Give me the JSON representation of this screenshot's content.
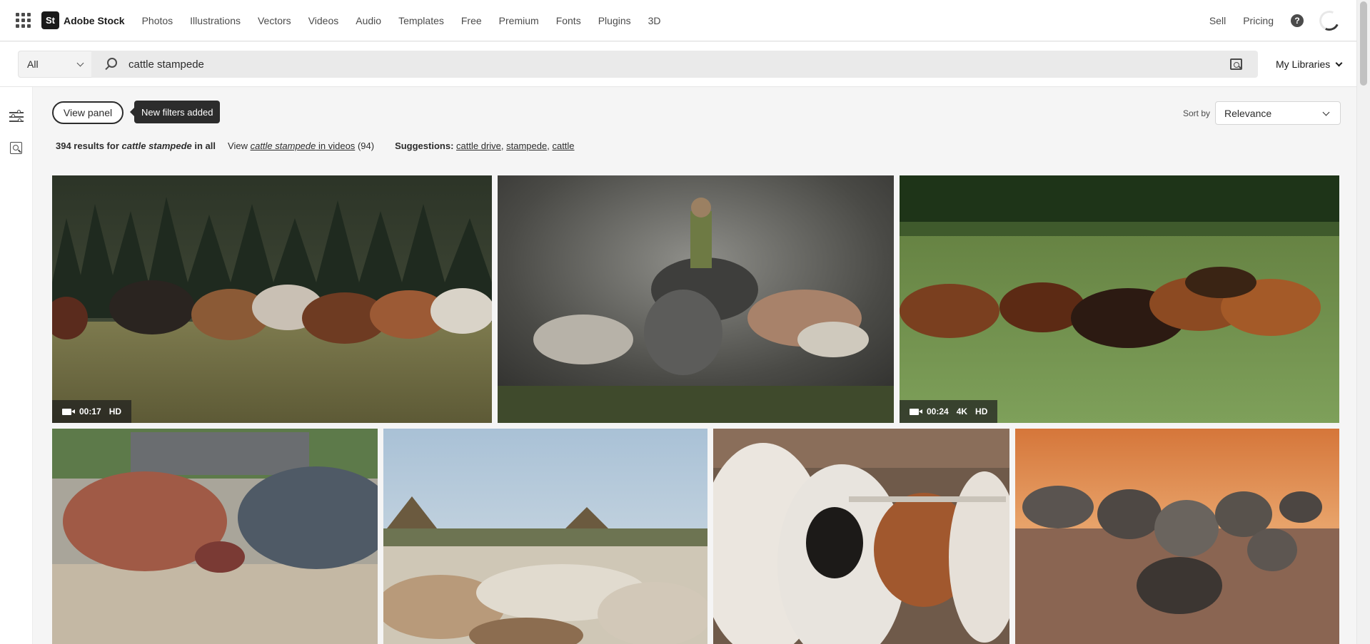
{
  "nav": {
    "brand_mark": "St",
    "brand": "Adobe Stock",
    "items": [
      "Photos",
      "Illustrations",
      "Vectors",
      "Videos",
      "Audio",
      "Templates",
      "Free",
      "Premium",
      "Fonts",
      "Plugins",
      "3D"
    ],
    "sell": "Sell",
    "pricing": "Pricing",
    "help_glyph": "?"
  },
  "search": {
    "type": "All",
    "query": "cattle stampede",
    "libraries": "My Libraries"
  },
  "panel": {
    "view_panel": "View panel",
    "tooltip": "New filters added"
  },
  "sort": {
    "label": "Sort by",
    "value": "Relevance"
  },
  "results": {
    "count_text": "394 results for",
    "query": "cattle stampede",
    "scope": "in all",
    "view_prefix": "View",
    "view_query": "cattle stampede",
    "view_link": "in videos",
    "video_count": "(94)",
    "suggestions_label": "Suggestions:",
    "suggestions": [
      "cattle drive",
      "stampede",
      "cattle"
    ]
  },
  "assets": [
    {
      "type": "video",
      "duration": "00:17",
      "tags": [
        "HD"
      ]
    },
    {
      "type": "image"
    },
    {
      "type": "video",
      "duration": "00:24",
      "tags": [
        "4K",
        "HD"
      ]
    },
    {
      "type": "image"
    },
    {
      "type": "image"
    },
    {
      "type": "image"
    },
    {
      "type": "image"
    }
  ]
}
